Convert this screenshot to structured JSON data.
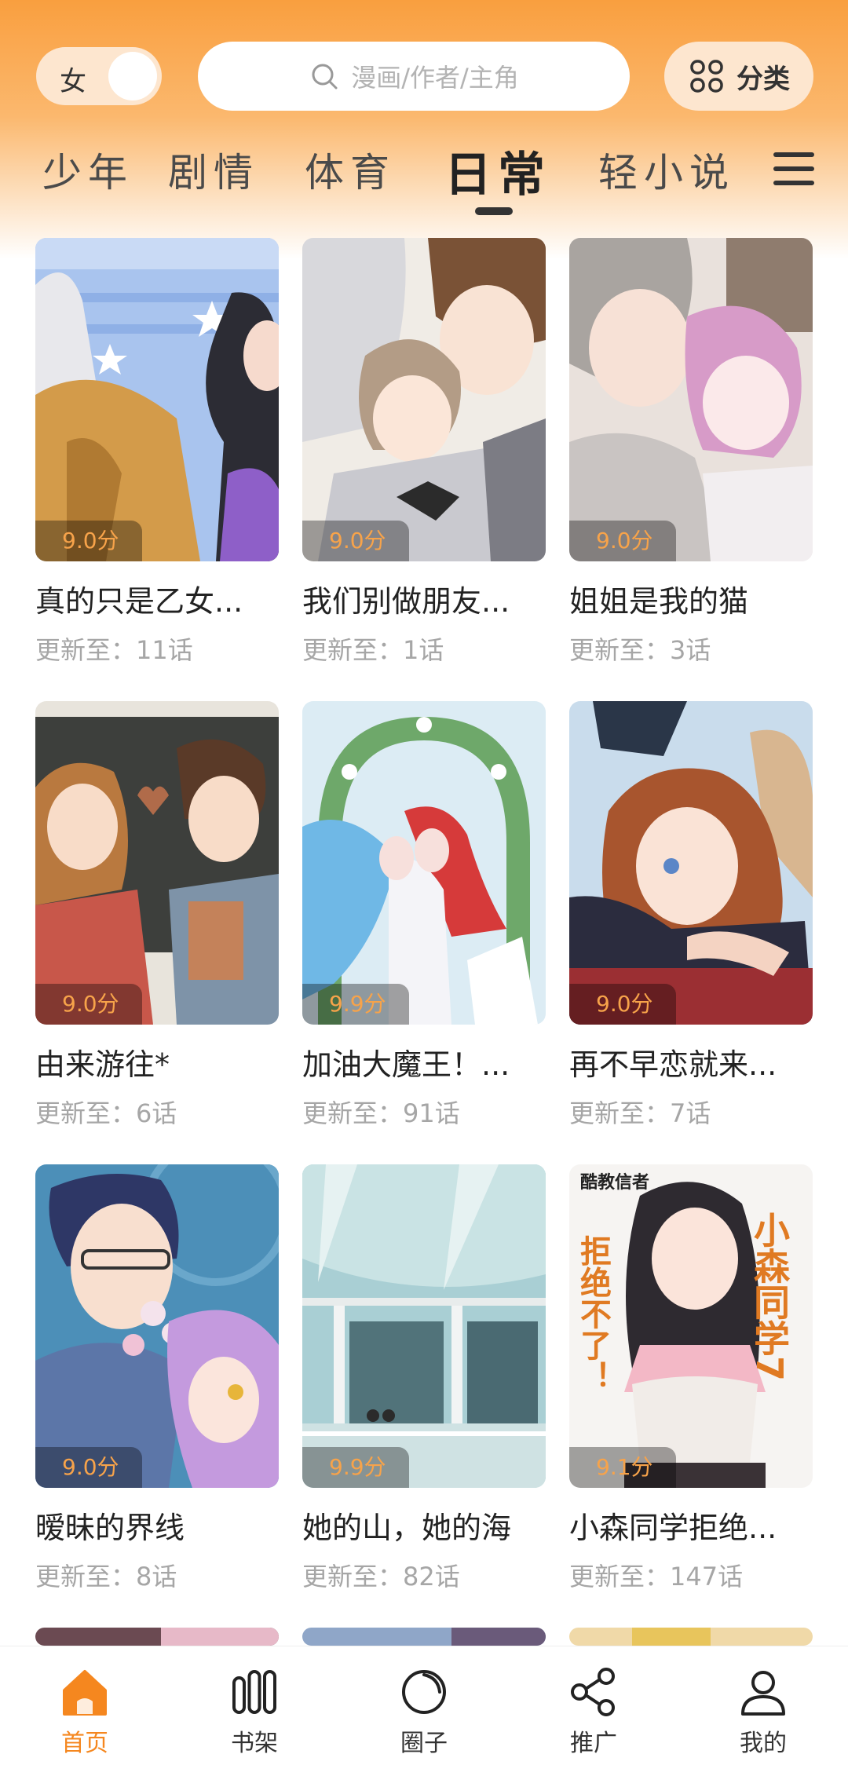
{
  "header": {
    "gender_label": "女",
    "search_placeholder": "漫画/作者/主角",
    "category_label": "分类"
  },
  "tabs": [
    {
      "label": "少年",
      "active": false
    },
    {
      "label": "剧情",
      "active": false
    },
    {
      "label": "体育",
      "active": false
    },
    {
      "label": "日常",
      "active": true
    },
    {
      "label": "轻小说",
      "active": false
    }
  ],
  "comics": [
    {
      "title": "真的只是乙女...",
      "score": "9.0分",
      "update": "更新至：11话"
    },
    {
      "title": "我们别做朋友...",
      "score": "9.0分",
      "update": "更新至：1话"
    },
    {
      "title": "姐姐是我的猫",
      "score": "9.0分",
      "update": "更新至：3话"
    },
    {
      "title": "由来游往*",
      "score": "9.0分",
      "update": "更新至：6话"
    },
    {
      "title": "加油大魔王！...",
      "score": "9.9分",
      "update": "更新至：91话"
    },
    {
      "title": "再不早恋就来...",
      "score": "9.0分",
      "update": "更新至：7话"
    },
    {
      "title": "暧昧的界线",
      "score": "9.0分",
      "update": "更新至：8话"
    },
    {
      "title": "她的山，她的海",
      "score": "9.9分",
      "update": "更新至：82话"
    },
    {
      "title": "小森同学拒绝...",
      "score": "9.1分",
      "update": "更新至：147话",
      "cover_text": [
        "酷教信者",
        "小森同学7",
        "拒绝不了！"
      ]
    }
  ],
  "bottom_nav": [
    {
      "label": "首页",
      "icon": "home-icon",
      "active": true
    },
    {
      "label": "书架",
      "icon": "bookshelf-icon",
      "active": false
    },
    {
      "label": "圈子",
      "icon": "circle-icon",
      "active": false
    },
    {
      "label": "推广",
      "icon": "share-icon",
      "active": false
    },
    {
      "label": "我的",
      "icon": "user-icon",
      "active": false
    }
  ],
  "colors": {
    "accent": "#f5871f",
    "header_top": "#f99f3f",
    "score_text": "#f7a34a"
  }
}
